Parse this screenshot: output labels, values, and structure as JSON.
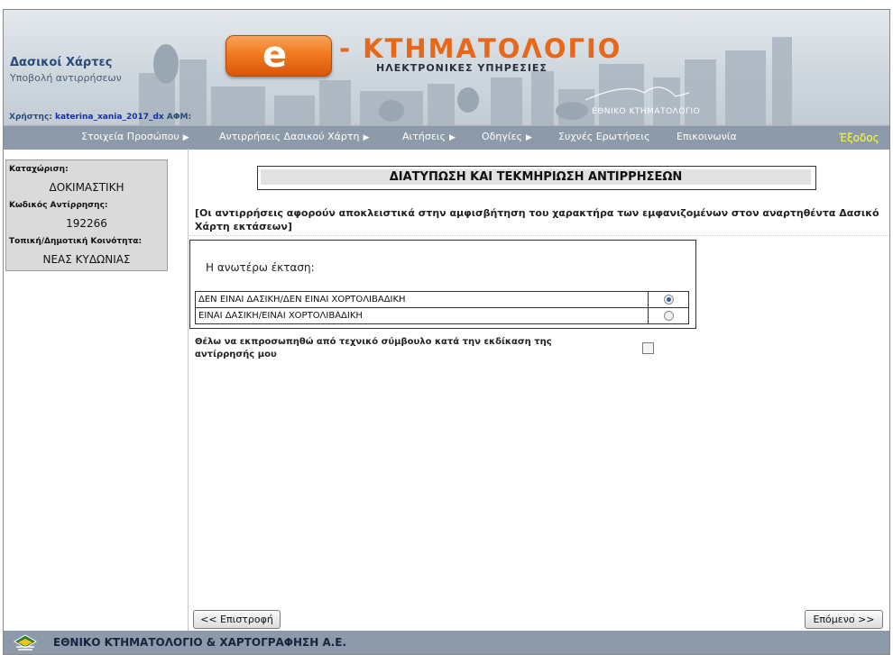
{
  "header": {
    "section_title": "Δασικοί Χάρτες",
    "section_subtitle": "Υποβολή αντιρρήσεων",
    "user_prefix": "Χρήστης:",
    "username": "katerina_xania_2017_dx",
    "afm_label": "ΑΦΜ:",
    "logo_letter": "e",
    "logo_title": "- ΚΤΗΜΑΤΟΛΟΓΙΟ",
    "logo_subtitle": "ΗΛΕΚΤΡΟΝΙΚΕΣ ΥΠΗΡΕΣΙΕΣ",
    "brand_text": "ΕΘΝΙΚΟ ΚΤΗΜΑΤΟΛΟΓΙΟ"
  },
  "nav": {
    "items": [
      {
        "label": "Στοιχεία Προσώπου",
        "arrow": "▶"
      },
      {
        "label": "Αντιρρήσεις Δασικού Χάρτη",
        "arrow": "▶"
      },
      {
        "label": "Αιτήσεις",
        "arrow": "▶"
      },
      {
        "label": "Οδηγίες",
        "arrow": "▶"
      },
      {
        "label": "Συχνές Ερωτήσεις",
        "arrow": ""
      },
      {
        "label": "Επικοινωνία",
        "arrow": ""
      }
    ],
    "exit_label": "Έξοδος"
  },
  "sidebar": {
    "registration_label": "Καταχώριση:",
    "registration_value": "ΔΟΚΙΜΑΣΤΙΚΗ",
    "objection_code_label": "Κωδικός Αντίρρησης:",
    "objection_code_value": "192266",
    "community_label": "Τοπική/Δημοτική Κοινότητα:",
    "community_value": "ΝΕΑΣ ΚΥΔΩΝΙΑΣ"
  },
  "main": {
    "title": "ΔΙΑΤΥΠΩΣΗ ΚΑΙ ΤΕΚΜΗΡΙΩΣΗ ΑΝΤΙΡΡΗΣΕΩΝ",
    "notice": "[Οι αντιρρήσεις αφορούν αποκλειστικά στην αμφισβήτηση του χαρακτήρα των εμφανιζομένων στον αναρτηθέντα Δασικό Χάρτη εκτάσεων]",
    "question_label": "Η ανωτέρω έκταση:",
    "options": [
      {
        "label": "ΔΕΝ ΕΙΝΑΙ ΔΑΣΙΚΗ/ΔΕΝ ΕΙΝΑΙ ΧΟΡΤΟΛΙΒΑΔΙΚΗ",
        "selected": true
      },
      {
        "label": "ΕΙΝΑΙ ΔΑΣΙΚΗ/ΕΙΝΑΙ ΧΟΡΤΟΛΙΒΑΔΙΚΗ",
        "selected": false
      }
    ],
    "consult_label": "Θέλω να εκπροσωπηθώ από τεχνικό σύμβουλο κατά την εκδίκαση της αντίρρησής μου",
    "consult_checked": false,
    "back_button": "<< Επιστροφή",
    "next_button": "Επόμενο >>"
  },
  "footer": {
    "org_name": "ΕΘΝΙΚΟ ΚΤΗΜΑΤΟΛΟΓΙΟ & ΧΑΡΤΟΓΡΑΦΗΣΗ Α.Ε."
  },
  "colors": {
    "nav_bg": "#8c9aa9",
    "accent_orange": "#e8681a",
    "exit_yellow": "#ffff33",
    "link_blue": "#1230a8"
  }
}
